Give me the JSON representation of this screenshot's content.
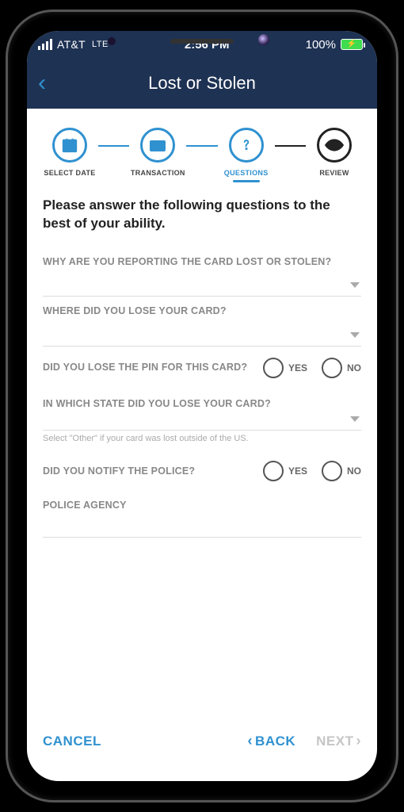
{
  "statusbar": {
    "carrier": "AT&T",
    "network": "LTE",
    "time": "2:56 PM",
    "battery_pct": "100%"
  },
  "header": {
    "title": "Lost or Stolen"
  },
  "stepper": {
    "steps": [
      "SELECT DATE",
      "TRANSACTION",
      "QUESTIONS",
      "REVIEW"
    ],
    "active_index": 2
  },
  "prompt": "Please answer the following questions to the best of your ability.",
  "questions": {
    "q1_label": "WHY ARE YOU REPORTING THE CARD LOST OR STOLEN?",
    "q2_label": "WHERE DID YOU LOSE YOUR CARD?",
    "q3_label": "DID YOU LOSE THE PIN FOR THIS CARD?",
    "q4_label": "IN WHICH STATE DID YOU LOSE YOUR CARD?",
    "q4_helper": "Select \"Other\" if your card was lost outside of the US.",
    "q5_label": "DID YOU NOTIFY THE POLICE?",
    "q6_label": "POLICE AGENCY",
    "opt_yes": "YES",
    "opt_no": "NO"
  },
  "footer": {
    "cancel": "CANCEL",
    "back": "BACK",
    "next": "NEXT"
  }
}
